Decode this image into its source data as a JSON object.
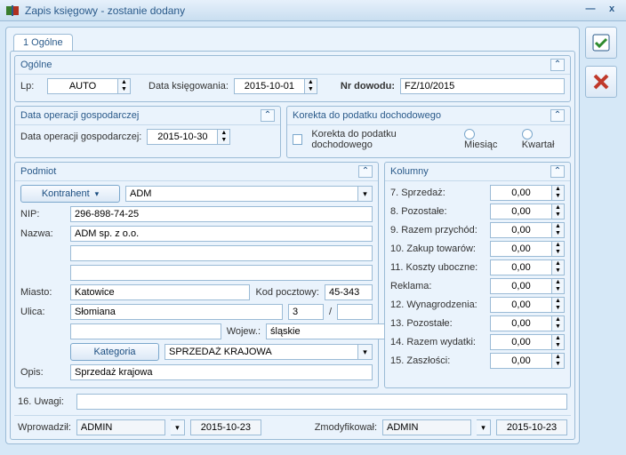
{
  "window": {
    "title": "Zapis księgowy - zostanie dodany"
  },
  "tab": {
    "label": "1 Ogólne"
  },
  "general": {
    "title": "Ogólne",
    "lp_label": "Lp:",
    "lp_value": "AUTO",
    "date_label": "Data księgowania:",
    "date_value": "2015-10-01",
    "docno_label": "Nr dowodu:",
    "docno_value": "FZ/10/2015"
  },
  "opdate": {
    "title": "Data operacji gospodarczej",
    "label": "Data operacji gospodarczej:",
    "value": "2015-10-30"
  },
  "tax": {
    "title": "Korekta do podatku dochodowego",
    "chk_label": "Korekta do podatku dochodowego",
    "opt1": "Miesiąc",
    "opt2": "Kwartał"
  },
  "subject": {
    "title": "Podmiot",
    "contractor_btn": "Kontrahent",
    "contractor_val": "ADM",
    "nip_label": "NIP:",
    "nip_value": "296-898-74-25",
    "name_label": "Nazwa:",
    "name_value": "ADM sp. z o.o.",
    "city_label": "Miasto:",
    "city_value": "Katowice",
    "zip_label": "Kod pocztowy:",
    "zip_value": "45-343",
    "street_label": "Ulica:",
    "street_value": "Słomiana",
    "house_no": "3",
    "slash": "/",
    "apt_no": "",
    "voiv_label": "Wojew.:",
    "voiv_value": "śląskie",
    "category_btn": "Kategoria",
    "category_val": "SPRZEDAŻ KRAJOWA",
    "desc_label": "Opis:",
    "desc_value": "Sprzedaż krajowa"
  },
  "columns": {
    "title": "Kolumny",
    "rows": [
      {
        "label": "7. Sprzedaż:",
        "value": "0,00"
      },
      {
        "label": "8. Pozostałe:",
        "value": "0,00"
      },
      {
        "label": "9. Razem przychód:",
        "value": "0,00"
      },
      {
        "label": "10. Zakup towarów:",
        "value": "0,00"
      },
      {
        "label": "11. Koszty uboczne:",
        "value": "0,00"
      },
      {
        "label": "Reklama:",
        "value": "0,00"
      },
      {
        "label": "12. Wynagrodzenia:",
        "value": "0,00"
      },
      {
        "label": "13. Pozostałe:",
        "value": "0,00"
      },
      {
        "label": "14. Razem wydatki:",
        "value": "0,00"
      },
      {
        "label": "15. Zaszłości:",
        "value": "0,00"
      }
    ]
  },
  "remarks": {
    "label": "16. Uwagi:",
    "value": ""
  },
  "audit": {
    "created_label": "Wprowadził:",
    "created_by": "ADMIN",
    "created_on": "2015-10-23",
    "modified_label": "Zmodyfikował:",
    "modified_by": "ADMIN",
    "modified_on": "2015-10-23"
  }
}
